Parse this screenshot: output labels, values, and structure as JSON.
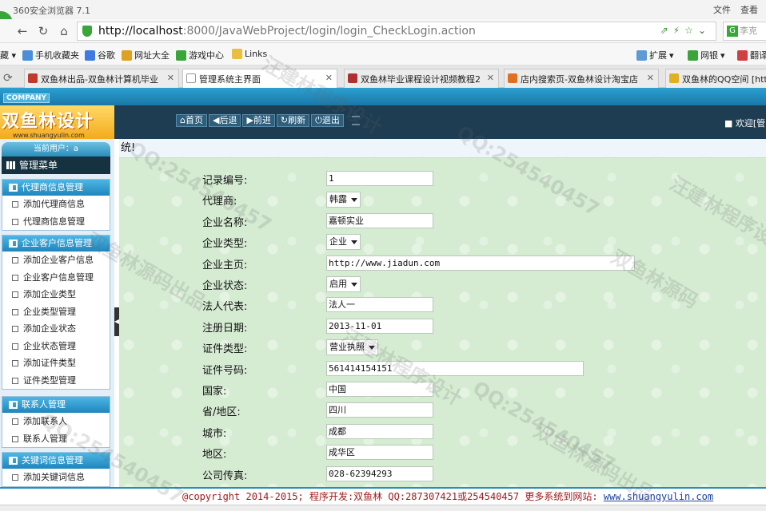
{
  "browser": {
    "app_title": "360安全浏览器 7.1",
    "menu_file": "文件",
    "menu_view": "查看",
    "url_host": "http://localhost",
    "url_rest": ":8000/JavaWebProject/login/login_CheckLogin.action",
    "search_placeholder": "李克",
    "bookmarks": [
      {
        "label": "手机收藏夹",
        "color": "#4a90d9"
      },
      {
        "label": "谷歌",
        "color": "#3d7be0"
      },
      {
        "label": "网址大全",
        "color": "#e0a020"
      },
      {
        "label": "游戏中心",
        "color": "#3aa63a"
      },
      {
        "label": "Links",
        "color": "#e8c040"
      }
    ],
    "bookmarks_right": [
      {
        "label": "扩展",
        "color": "#5c9bd6"
      },
      {
        "label": "网银",
        "color": "#3aa63a"
      },
      {
        "label": "翻译",
        "color": "#d04040"
      }
    ],
    "tabs": [
      {
        "label": "双鱼林出品-双鱼林计算机毕业",
        "color": "#c0392b",
        "active": false
      },
      {
        "label": "管理系统主界面",
        "color": "#ffffff",
        "active": true
      },
      {
        "label": "双鱼林毕业课程设计视频教程2",
        "color": "#b03030",
        "active": false
      },
      {
        "label": "店内搜索页-双鱼林设计淘宝店",
        "color": "#e07020",
        "active": false
      },
      {
        "label": "双鱼林的QQ空间 [htt",
        "color": "#e0b020",
        "active": false
      }
    ]
  },
  "header": {
    "company": "COMPANY",
    "brand_name": "双鱼林设计",
    "brand_site": "www.shuangyulin.com",
    "toolbar": [
      "首页",
      "后退",
      "前进",
      "刷新",
      "退出"
    ],
    "welcome": "欢迎[管"
  },
  "sidebar": {
    "current_user": "当前用户：a",
    "menu_title": "管理菜单",
    "groups": [
      {
        "title": "代理商信息管理",
        "items": [
          "添加代理商信息",
          "代理商信息管理"
        ]
      },
      {
        "title": "企业客户信息管理",
        "items": [
          "添加企业客户信息",
          "企业客户信息管理",
          "添加企业类型",
          "企业类型管理",
          "添加企业状态",
          "企业状态管理",
          "添加证件类型",
          "证件类型管理"
        ]
      },
      {
        "title": "联系人管理",
        "items": [
          "添加联系人",
          "联系人管理"
        ]
      },
      {
        "title": "关键词信息管理",
        "items": [
          "添加关键词信息"
        ]
      }
    ]
  },
  "main": {
    "heading": "统!",
    "fields": [
      {
        "label": "记录编号:",
        "value": "1",
        "type": "input",
        "width": 134
      },
      {
        "label": "代理商:",
        "value": "韩露",
        "type": "select"
      },
      {
        "label": "企业名称:",
        "value": "嘉顿实业",
        "type": "input",
        "width": 134
      },
      {
        "label": "企业类型:",
        "value": "企业",
        "type": "select"
      },
      {
        "label": "企业主页:",
        "value": "http://www.jiadun.com",
        "type": "input",
        "width": 386
      },
      {
        "label": "企业状态:",
        "value": "启用",
        "type": "select"
      },
      {
        "label": "法人代表:",
        "value": "法人一",
        "type": "input",
        "width": 134
      },
      {
        "label": "注册日期:",
        "value": "2013-11-01",
        "type": "input",
        "width": 134
      },
      {
        "label": "证件类型:",
        "value": "营业执照",
        "type": "select"
      },
      {
        "label": "证件号码:",
        "value": "561414154151",
        "type": "input",
        "width": 322
      },
      {
        "label": "国家:",
        "value": "中国",
        "type": "input",
        "width": 134
      },
      {
        "label": "省/地区:",
        "value": "四川",
        "type": "input",
        "width": 134
      },
      {
        "label": "城市:",
        "value": "成都",
        "type": "input",
        "width": 134
      },
      {
        "label": "地区:",
        "value": "成华区",
        "type": "input",
        "width": 134
      },
      {
        "label": "公司传真:",
        "value": "028-62394293",
        "type": "input",
        "width": 134
      }
    ]
  },
  "footer": {
    "text": "@copyright 2014-2015; 程序开发:双鱼林  QQ:287307421或254540457  更多系统到网站:",
    "link": "www.shuangyulin.com"
  },
  "watermarks": [
    "QQ:254540457",
    "双鱼林源码出品",
    "汪建林程序设计",
    "QQ:254540457",
    "双鱼林源码",
    "QQ:254540457",
    "汪建林程序设计",
    "双鱼林源码出品",
    "QQ:254540457",
    "汪建林程序设计"
  ]
}
